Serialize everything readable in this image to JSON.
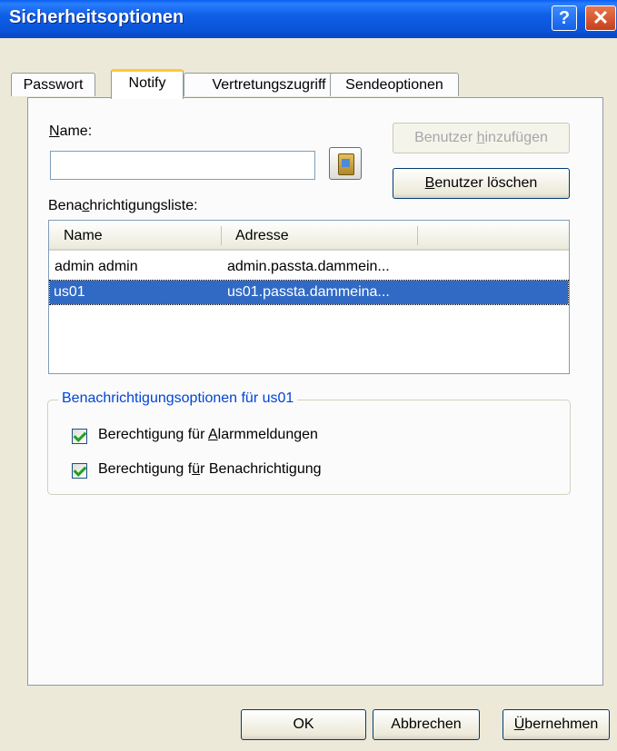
{
  "window": {
    "title": "Sicherheitsoptionen",
    "help_glyph": "?",
    "close_glyph": "✕"
  },
  "tabs": [
    {
      "label": "Passwort"
    },
    {
      "label": "Notify",
      "active": true
    },
    {
      "label": "Vertretungszugriff"
    },
    {
      "label": "Sendeoptionen"
    }
  ],
  "name_field": {
    "label_hotkey": "N",
    "label_rest": "ame:",
    "value": ""
  },
  "address_book_icon": "address-book-icon",
  "buttons": {
    "add_user": {
      "pre": "Benutzer ",
      "hotkey": "h",
      "post": "inzufügen",
      "disabled": true
    },
    "delete_user": {
      "pre": "",
      "hotkey": "B",
      "post": "enutzer löschen"
    }
  },
  "notification_list": {
    "label_pre": "Bena",
    "label_hotkey": "c",
    "label_post": "hrichtigungsliste:",
    "columns": [
      "Name",
      "Adresse"
    ],
    "rows": [
      {
        "name": "admin admin",
        "address": "admin.passta.dammein...",
        "selected": false
      },
      {
        "name": "us01",
        "address": "us01.passta.dammeina...",
        "selected": true
      }
    ]
  },
  "options_group": {
    "title": "Benachrichtigungsoptionen für us01",
    "alarm": {
      "pre": "Berechtigung für ",
      "hotkey": "A",
      "post": "larmmeldungen",
      "checked": true
    },
    "notify": {
      "pre": "Berechtigung f",
      "hotkey": "ü",
      "post": "r Benachrichtigung",
      "checked": true
    }
  },
  "footer": {
    "ok": "OK",
    "cancel": "Abbrechen",
    "apply": {
      "hotkey": "Ü",
      "post": "bernehmen"
    }
  },
  "colors": {
    "selection": "#316ac5",
    "group_title": "#0046d5",
    "titlebar": "#0a54d8"
  }
}
